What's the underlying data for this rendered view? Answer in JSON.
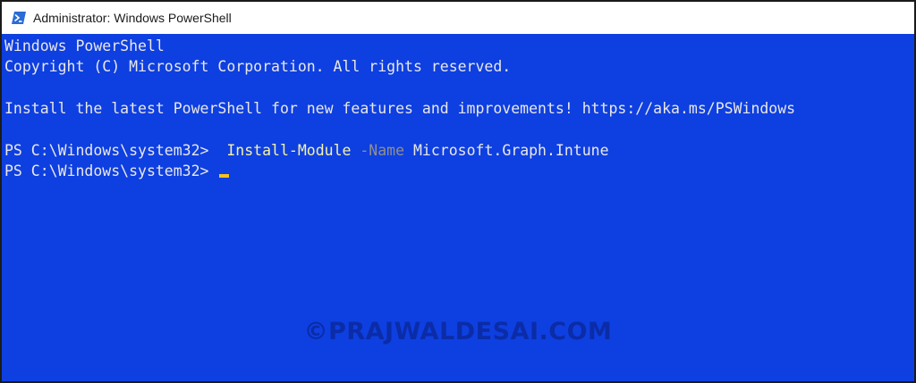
{
  "window": {
    "title": "Administrator: Windows PowerShell",
    "icon": "powershell-icon"
  },
  "console": {
    "banner_line1": "Windows PowerShell",
    "banner_line2": "Copyright (C) Microsoft Corporation. All rights reserved.",
    "install_notice": "Install the latest PowerShell for new features and improvements! https://aka.ms/PSWindows",
    "prompt1": "PS C:\\Windows\\system32>  ",
    "command": "Install-Module",
    "param_name": "-Name",
    "param_value": "Microsoft.Graph.Intune",
    "prompt2": "PS C:\\Windows\\system32> "
  },
  "watermark": "©PRAJWALDESAI.COM",
  "colors": {
    "console_background": "#0e3fe0",
    "text": "#e8e8e8",
    "command": "#f5f3a8",
    "parameter": "#8f8f8f",
    "cursor": "#f4c21d"
  }
}
